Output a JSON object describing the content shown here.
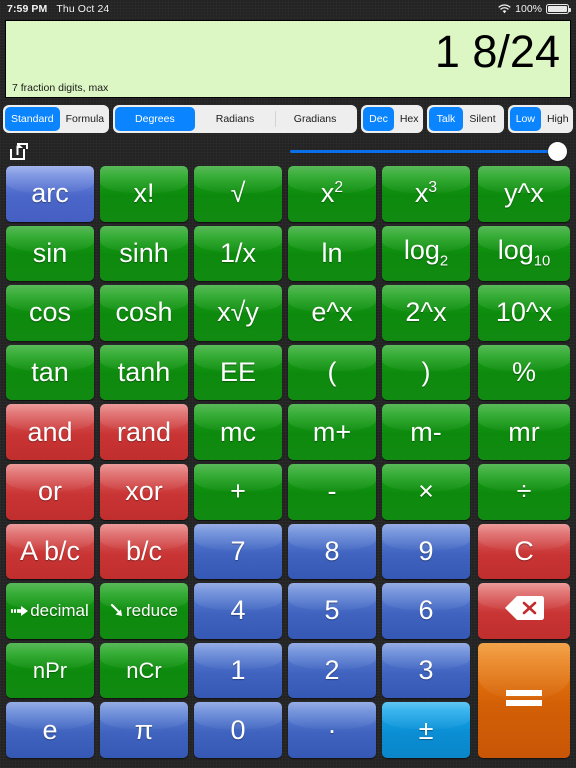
{
  "statusbar": {
    "time": "7:59 PM",
    "date": "Thu Oct 24",
    "battery_pct": "100%",
    "wifi_icon": "wifi-icon",
    "battery_icon": "battery-icon"
  },
  "display": {
    "value": "1 8/24",
    "note": "7 fraction digits, max",
    "background_color": "#ddf7c4"
  },
  "segments": {
    "accent_color": "#0a84ff",
    "mode": {
      "options": [
        "Standard",
        "Formula"
      ],
      "selected": "Standard"
    },
    "angle": {
      "options": [
        "Degrees",
        "Radians",
        "Gradians"
      ],
      "selected": "Degrees"
    },
    "base": {
      "options": [
        "Dec",
        "Hex"
      ],
      "selected": "Dec"
    },
    "speech": {
      "options": [
        "Talk",
        "Silent"
      ],
      "selected": "Talk"
    },
    "volume": {
      "options": [
        "Low",
        "High"
      ],
      "selected": "High"
    }
  },
  "toolbar": {
    "share_icon": "share-icon",
    "slider_value": 100
  },
  "keypad": {
    "rows": [
      [
        {
          "label": "arc",
          "color": "purple",
          "size": "normal"
        },
        {
          "label": "x!",
          "color": "green",
          "size": "normal"
        },
        {
          "label": "√",
          "color": "green",
          "size": "normal"
        },
        {
          "label": "x2",
          "color": "green",
          "size": "normal",
          "sup": "2",
          "base": "x"
        },
        {
          "label": "x3",
          "color": "green",
          "size": "normal",
          "sup": "3",
          "base": "x"
        },
        {
          "label": "y^x",
          "color": "green",
          "size": "normal"
        }
      ],
      [
        {
          "label": "sin",
          "color": "green",
          "size": "normal"
        },
        {
          "label": "sinh",
          "color": "green",
          "size": "normal"
        },
        {
          "label": "1/x",
          "color": "green",
          "size": "normal"
        },
        {
          "label": "ln",
          "color": "green",
          "size": "normal"
        },
        {
          "label": "log2",
          "color": "green",
          "size": "normal",
          "sub": "2",
          "base": "log"
        },
        {
          "label": "log10",
          "color": "green",
          "size": "normal",
          "sub": "10",
          "base": "log"
        }
      ],
      [
        {
          "label": "cos",
          "color": "green",
          "size": "normal"
        },
        {
          "label": "cosh",
          "color": "green",
          "size": "normal"
        },
        {
          "label": "x√y",
          "color": "green",
          "size": "normal"
        },
        {
          "label": "e^x",
          "color": "green",
          "size": "normal"
        },
        {
          "label": "2^x",
          "color": "green",
          "size": "normal"
        },
        {
          "label": "10^x",
          "color": "green",
          "size": "normal"
        }
      ],
      [
        {
          "label": "tan",
          "color": "green",
          "size": "normal"
        },
        {
          "label": "tanh",
          "color": "green",
          "size": "normal"
        },
        {
          "label": "EE",
          "color": "green",
          "size": "normal"
        },
        {
          "label": "(",
          "color": "green",
          "size": "normal"
        },
        {
          "label": ")",
          "color": "green",
          "size": "normal"
        },
        {
          "label": "%",
          "color": "green",
          "size": "normal"
        }
      ],
      [
        {
          "label": "and",
          "color": "red",
          "size": "normal"
        },
        {
          "label": "rand",
          "color": "red",
          "size": "normal"
        },
        {
          "label": "mc",
          "color": "green",
          "size": "normal"
        },
        {
          "label": "m+",
          "color": "green",
          "size": "normal"
        },
        {
          "label": "m-",
          "color": "green",
          "size": "normal"
        },
        {
          "label": "mr",
          "color": "green",
          "size": "normal"
        }
      ],
      [
        {
          "label": "or",
          "color": "red",
          "size": "normal"
        },
        {
          "label": "xor",
          "color": "red",
          "size": "normal"
        },
        {
          "label": "+",
          "color": "green",
          "size": "normal"
        },
        {
          "label": "-",
          "color": "green",
          "size": "normal"
        },
        {
          "label": "×",
          "color": "green",
          "size": "normal"
        },
        {
          "label": "÷",
          "color": "green",
          "size": "normal"
        }
      ],
      [
        {
          "label": "A b/c",
          "color": "red",
          "size": "normal"
        },
        {
          "label": "b/c",
          "color": "red",
          "size": "normal"
        },
        {
          "label": "7",
          "color": "blue",
          "size": "normal"
        },
        {
          "label": "8",
          "color": "blue",
          "size": "normal"
        },
        {
          "label": "9",
          "color": "blue",
          "size": "normal"
        },
        {
          "label": "C",
          "color": "red",
          "size": "normal"
        }
      ],
      [
        {
          "label": "decimal",
          "color": "green",
          "size": "tiny",
          "icon": "arrow-right-icon"
        },
        {
          "label": "reduce",
          "color": "green",
          "size": "tiny",
          "icon": "arrow-down-right-icon"
        },
        {
          "label": "4",
          "color": "blue",
          "size": "normal"
        },
        {
          "label": "5",
          "color": "blue",
          "size": "normal"
        },
        {
          "label": "6",
          "color": "blue",
          "size": "normal"
        },
        {
          "label": "",
          "color": "red",
          "size": "normal",
          "icon": "backspace-icon"
        }
      ],
      [
        {
          "label": "nPr",
          "color": "green",
          "size": "small"
        },
        {
          "label": "nCr",
          "color": "green",
          "size": "small"
        },
        {
          "label": "1",
          "color": "blue",
          "size": "normal"
        },
        {
          "label": "2",
          "color": "blue",
          "size": "normal"
        },
        {
          "label": "3",
          "color": "blue",
          "size": "normal"
        },
        {
          "label": "",
          "color": "orange",
          "size": "normal",
          "icon": "equals-icon",
          "tall": true
        }
      ],
      [
        {
          "label": "e",
          "color": "blue",
          "size": "normal"
        },
        {
          "label": "π",
          "color": "blue",
          "size": "normal"
        },
        {
          "label": "0",
          "color": "blue",
          "size": "normal"
        },
        {
          "label": "·",
          "color": "blue",
          "size": "normal"
        },
        {
          "label": "±",
          "color": "cyan",
          "size": "normal"
        }
      ]
    ]
  }
}
